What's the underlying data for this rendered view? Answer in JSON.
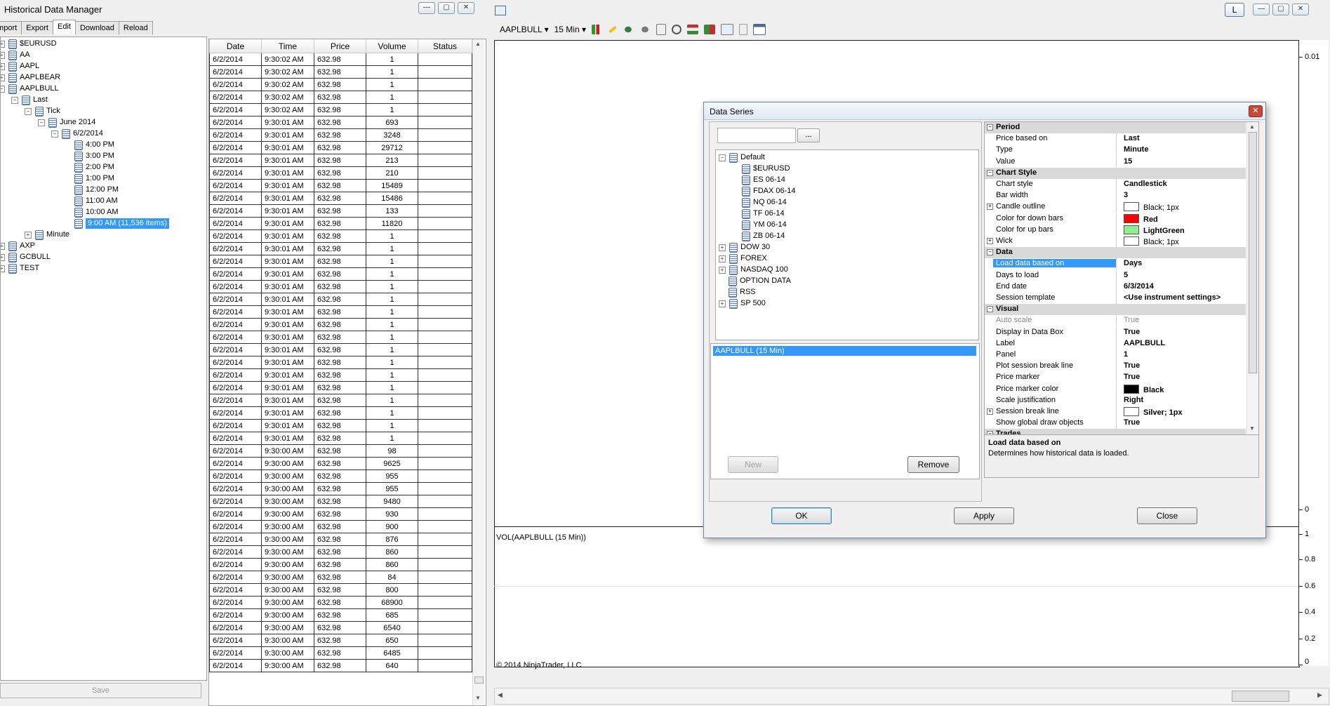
{
  "hdm": {
    "title": "Historical Data Manager",
    "tabs": [
      "Import",
      "Export",
      "Edit",
      "Download",
      "Reload"
    ],
    "save_label": "Save",
    "tree": [
      {
        "label": "$EURUSD",
        "level": 0,
        "exp": "+"
      },
      {
        "label": "AA",
        "level": 0,
        "exp": "+"
      },
      {
        "label": "AAPL",
        "level": 0,
        "exp": "+"
      },
      {
        "label": "AAPLBEAR",
        "level": 0,
        "exp": "+"
      },
      {
        "label": "AAPLBULL",
        "level": 0,
        "exp": "-"
      },
      {
        "label": "Last",
        "level": 1,
        "exp": "-"
      },
      {
        "label": "Tick",
        "level": 2,
        "exp": "-"
      },
      {
        "label": "June 2014",
        "level": 3,
        "exp": "-"
      },
      {
        "label": "6/2/2014",
        "level": 4,
        "exp": "-"
      },
      {
        "label": "4:00 PM",
        "level": 5,
        "exp": ""
      },
      {
        "label": "3:00 PM",
        "level": 5,
        "exp": ""
      },
      {
        "label": "2:00 PM",
        "level": 5,
        "exp": ""
      },
      {
        "label": "1:00 PM",
        "level": 5,
        "exp": ""
      },
      {
        "label": "12:00 PM",
        "level": 5,
        "exp": ""
      },
      {
        "label": "11:00 AM",
        "level": 5,
        "exp": ""
      },
      {
        "label": "10:00 AM",
        "level": 5,
        "exp": ""
      },
      {
        "label": "9:00 AM (11,536 items)",
        "level": 5,
        "exp": "",
        "selected": true
      },
      {
        "label": "Minute",
        "level": 2,
        "exp": "+"
      },
      {
        "label": "AXP",
        "level": 0,
        "exp": "+"
      },
      {
        "label": "GCBULL",
        "level": 0,
        "exp": "+"
      },
      {
        "label": "TEST",
        "level": 0,
        "exp": "+"
      }
    ],
    "grid": {
      "columns": [
        "Date",
        "Time",
        "Price",
        "Volume",
        "Status"
      ],
      "rows": [
        [
          "6/2/2014",
          "9:30:02 AM",
          "632.98",
          "1",
          ""
        ],
        [
          "6/2/2014",
          "9:30:02 AM",
          "632.98",
          "1",
          ""
        ],
        [
          "6/2/2014",
          "9:30:02 AM",
          "632.98",
          "1",
          ""
        ],
        [
          "6/2/2014",
          "9:30:02 AM",
          "632.98",
          "1",
          ""
        ],
        [
          "6/2/2014",
          "9:30:02 AM",
          "632.98",
          "1",
          ""
        ],
        [
          "6/2/2014",
          "9:30:01 AM",
          "632.98",
          "693",
          ""
        ],
        [
          "6/2/2014",
          "9:30:01 AM",
          "632.98",
          "3248",
          ""
        ],
        [
          "6/2/2014",
          "9:30:01 AM",
          "632.98",
          "29712",
          ""
        ],
        [
          "6/2/2014",
          "9:30:01 AM",
          "632.98",
          "213",
          ""
        ],
        [
          "6/2/2014",
          "9:30:01 AM",
          "632.98",
          "210",
          ""
        ],
        [
          "6/2/2014",
          "9:30:01 AM",
          "632.98",
          "15489",
          ""
        ],
        [
          "6/2/2014",
          "9:30:01 AM",
          "632.98",
          "15486",
          ""
        ],
        [
          "6/2/2014",
          "9:30:01 AM",
          "632.98",
          "133",
          ""
        ],
        [
          "6/2/2014",
          "9:30:01 AM",
          "632.98",
          "11820",
          ""
        ],
        [
          "6/2/2014",
          "9:30:01 AM",
          "632.98",
          "1",
          ""
        ],
        [
          "6/2/2014",
          "9:30:01 AM",
          "632.98",
          "1",
          ""
        ],
        [
          "6/2/2014",
          "9:30:01 AM",
          "632.98",
          "1",
          ""
        ],
        [
          "6/2/2014",
          "9:30:01 AM",
          "632.98",
          "1",
          ""
        ],
        [
          "6/2/2014",
          "9:30:01 AM",
          "632.98",
          "1",
          ""
        ],
        [
          "6/2/2014",
          "9:30:01 AM",
          "632.98",
          "1",
          ""
        ],
        [
          "6/2/2014",
          "9:30:01 AM",
          "632.98",
          "1",
          ""
        ],
        [
          "6/2/2014",
          "9:30:01 AM",
          "632.98",
          "1",
          ""
        ],
        [
          "6/2/2014",
          "9:30:01 AM",
          "632.98",
          "1",
          ""
        ],
        [
          "6/2/2014",
          "9:30:01 AM",
          "632.98",
          "1",
          ""
        ],
        [
          "6/2/2014",
          "9:30:01 AM",
          "632.98",
          "1",
          ""
        ],
        [
          "6/2/2014",
          "9:30:01 AM",
          "632.98",
          "1",
          ""
        ],
        [
          "6/2/2014",
          "9:30:01 AM",
          "632.98",
          "1",
          ""
        ],
        [
          "6/2/2014",
          "9:30:01 AM",
          "632.98",
          "1",
          ""
        ],
        [
          "6/2/2014",
          "9:30:01 AM",
          "632.98",
          "1",
          ""
        ],
        [
          "6/2/2014",
          "9:30:01 AM",
          "632.98",
          "1",
          ""
        ],
        [
          "6/2/2014",
          "9:30:01 AM",
          "632.98",
          "1",
          ""
        ],
        [
          "6/2/2014",
          "9:30:00 AM",
          "632.98",
          "98",
          ""
        ],
        [
          "6/2/2014",
          "9:30:00 AM",
          "632.98",
          "9625",
          ""
        ],
        [
          "6/2/2014",
          "9:30:00 AM",
          "632.98",
          "955",
          ""
        ],
        [
          "6/2/2014",
          "9:30:00 AM",
          "632.98",
          "955",
          ""
        ],
        [
          "6/2/2014",
          "9:30:00 AM",
          "632.98",
          "9480",
          ""
        ],
        [
          "6/2/2014",
          "9:30:00 AM",
          "632.98",
          "930",
          ""
        ],
        [
          "6/2/2014",
          "9:30:00 AM",
          "632.98",
          "900",
          ""
        ],
        [
          "6/2/2014",
          "9:30:00 AM",
          "632.98",
          "876",
          ""
        ],
        [
          "6/2/2014",
          "9:30:00 AM",
          "632.98",
          "860",
          ""
        ],
        [
          "6/2/2014",
          "9:30:00 AM",
          "632.98",
          "860",
          ""
        ],
        [
          "6/2/2014",
          "9:30:00 AM",
          "632.98",
          "84",
          ""
        ],
        [
          "6/2/2014",
          "9:30:00 AM",
          "632.98",
          "800",
          ""
        ],
        [
          "6/2/2014",
          "9:30:00 AM",
          "632.98",
          "68900",
          ""
        ],
        [
          "6/2/2014",
          "9:30:00 AM",
          "632.98",
          "685",
          ""
        ],
        [
          "6/2/2014",
          "9:30:00 AM",
          "632.98",
          "6540",
          ""
        ],
        [
          "6/2/2014",
          "9:30:00 AM",
          "632.98",
          "650",
          ""
        ],
        [
          "6/2/2014",
          "9:30:00 AM",
          "632.98",
          "6485",
          ""
        ],
        [
          "6/2/2014",
          "9:30:00 AM",
          "632.98",
          "640",
          ""
        ]
      ]
    }
  },
  "chart": {
    "instrument": "AAPLBULL",
    "interval": "15 Min",
    "button_L": "L",
    "axis_top": [
      "0.01",
      "0"
    ],
    "axis_bottom": [
      "1",
      "0.8",
      "0.6",
      "0.4",
      "0.2",
      "0"
    ],
    "volume_label": "VOL(AAPLBULL (15 Min))",
    "copyright": "© 2014 NinjaTrader, LLC"
  },
  "dialog": {
    "title": "Data Series",
    "search_value": "",
    "browse_label": "...",
    "instrument_tree": [
      {
        "label": "Default",
        "level": 0,
        "exp": "-"
      },
      {
        "label": "$EURUSD",
        "level": 1,
        "exp": ""
      },
      {
        "label": "ES 06-14",
        "level": 1,
        "exp": ""
      },
      {
        "label": "FDAX 06-14",
        "level": 1,
        "exp": ""
      },
      {
        "label": "NQ 06-14",
        "level": 1,
        "exp": ""
      },
      {
        "label": "TF 06-14",
        "level": 1,
        "exp": ""
      },
      {
        "label": "YM 06-14",
        "level": 1,
        "exp": ""
      },
      {
        "label": "ZB 06-14",
        "level": 1,
        "exp": ""
      },
      {
        "label": "DOW 30",
        "level": 0,
        "exp": "+"
      },
      {
        "label": "FOREX",
        "level": 0,
        "exp": "+"
      },
      {
        "label": "NASDAQ 100",
        "level": 0,
        "exp": "+"
      },
      {
        "label": "OPTION DATA",
        "level": 0,
        "exp": ""
      },
      {
        "label": "RSS",
        "level": 0,
        "exp": ""
      },
      {
        "label": "SP 500",
        "level": 0,
        "exp": "+"
      }
    ],
    "selected_series": "AAPLBULL (15 Min)",
    "new_label": "New",
    "remove_label": "Remove",
    "ok_label": "OK",
    "apply_label": "Apply",
    "close_label": "Close",
    "properties": [
      {
        "cat": "Period"
      },
      {
        "label": "Price based on",
        "value": "Last"
      },
      {
        "label": "Type",
        "value": "Minute"
      },
      {
        "label": "Value",
        "value": "15"
      },
      {
        "cat": "Chart Style"
      },
      {
        "label": "Chart style",
        "value": "Candlestick"
      },
      {
        "label": "Bar width",
        "value": "3"
      },
      {
        "label": "Candle outline",
        "value": "Black; 1px",
        "swatch": "#ffffff",
        "exp": true,
        "normal": true
      },
      {
        "label": "Color for down bars",
        "value": "Red",
        "swatch": "#ff0000"
      },
      {
        "label": "Color for up bars",
        "value": "LightGreen",
        "swatch": "#90ee90"
      },
      {
        "label": "Wick",
        "value": "Black; 1px",
        "swatch": "#ffffff",
        "exp": true,
        "normal": true
      },
      {
        "cat": "Data"
      },
      {
        "label": "Load data based on",
        "value": "Days",
        "selected": true
      },
      {
        "label": "Days to load",
        "value": "5"
      },
      {
        "label": "End date",
        "value": "6/3/2014"
      },
      {
        "label": "Session template",
        "value": "<Use instrument settings>"
      },
      {
        "cat": "Visual"
      },
      {
        "label": "Auto scale",
        "value": "True",
        "dim": true
      },
      {
        "label": "Display in Data Box",
        "value": "True"
      },
      {
        "label": "Label",
        "value": "AAPLBULL"
      },
      {
        "label": "Panel",
        "value": "1"
      },
      {
        "label": "Plot session break line",
        "value": "True"
      },
      {
        "label": "Price marker",
        "value": "True"
      },
      {
        "label": "Price marker color",
        "value": "Black",
        "swatch": "#000000"
      },
      {
        "label": "Scale justification",
        "value": "Right"
      },
      {
        "label": "Session break line",
        "value": "Silver; 1px",
        "swatch": "#ffffff",
        "exp": true
      },
      {
        "label": "Show global draw objects",
        "value": "True"
      },
      {
        "cat": "Trades"
      }
    ],
    "desc_title": "Load data based on",
    "desc_text": "Determines how historical data is loaded."
  }
}
